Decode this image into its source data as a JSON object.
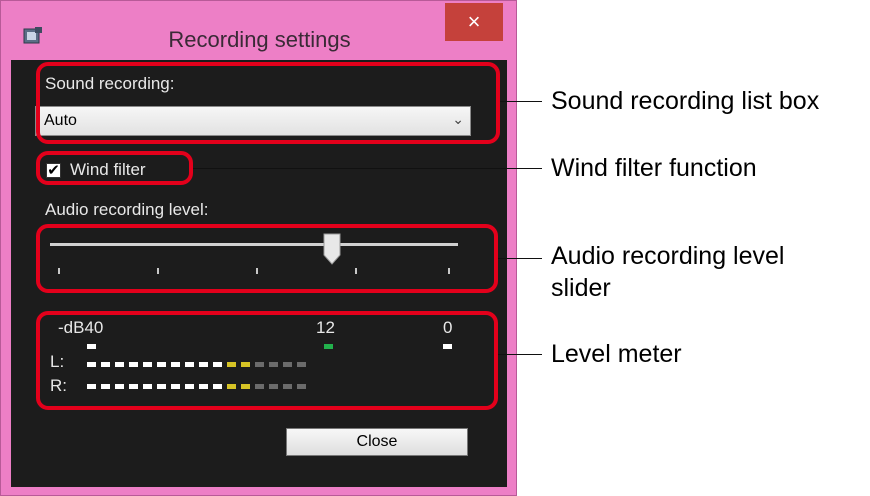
{
  "window": {
    "title": "Recording settings",
    "close_glyph": "×",
    "app_icon": "app-window-icon"
  },
  "sound_recording": {
    "label": "Sound recording:",
    "selected": "Auto",
    "dropdown_icon": "chevron-down-icon"
  },
  "wind_filter": {
    "label": "Wind filter",
    "checked": true,
    "check_glyph": "✔"
  },
  "audio_level": {
    "label": "Audio recording level:",
    "slider_value": 0.69,
    "tick_count": 5
  },
  "meter": {
    "scale_left": "-dB40",
    "scale_mid": "12",
    "scale_right": "0",
    "left_label": "L:",
    "right_label": "R:",
    "segments": 16,
    "colors": {
      "white": "#ffffff",
      "yellow": "#d6c325",
      "gray": "#6b6b6b",
      "green": "#22b14c"
    }
  },
  "close_button": "Close",
  "callouts": {
    "sound": "Sound recording list box",
    "wind": "Wind filter function",
    "slider_line1": "Audio recording level",
    "slider_line2": "slider",
    "meter": "Level meter"
  },
  "highlight_color": "#e3001b"
}
